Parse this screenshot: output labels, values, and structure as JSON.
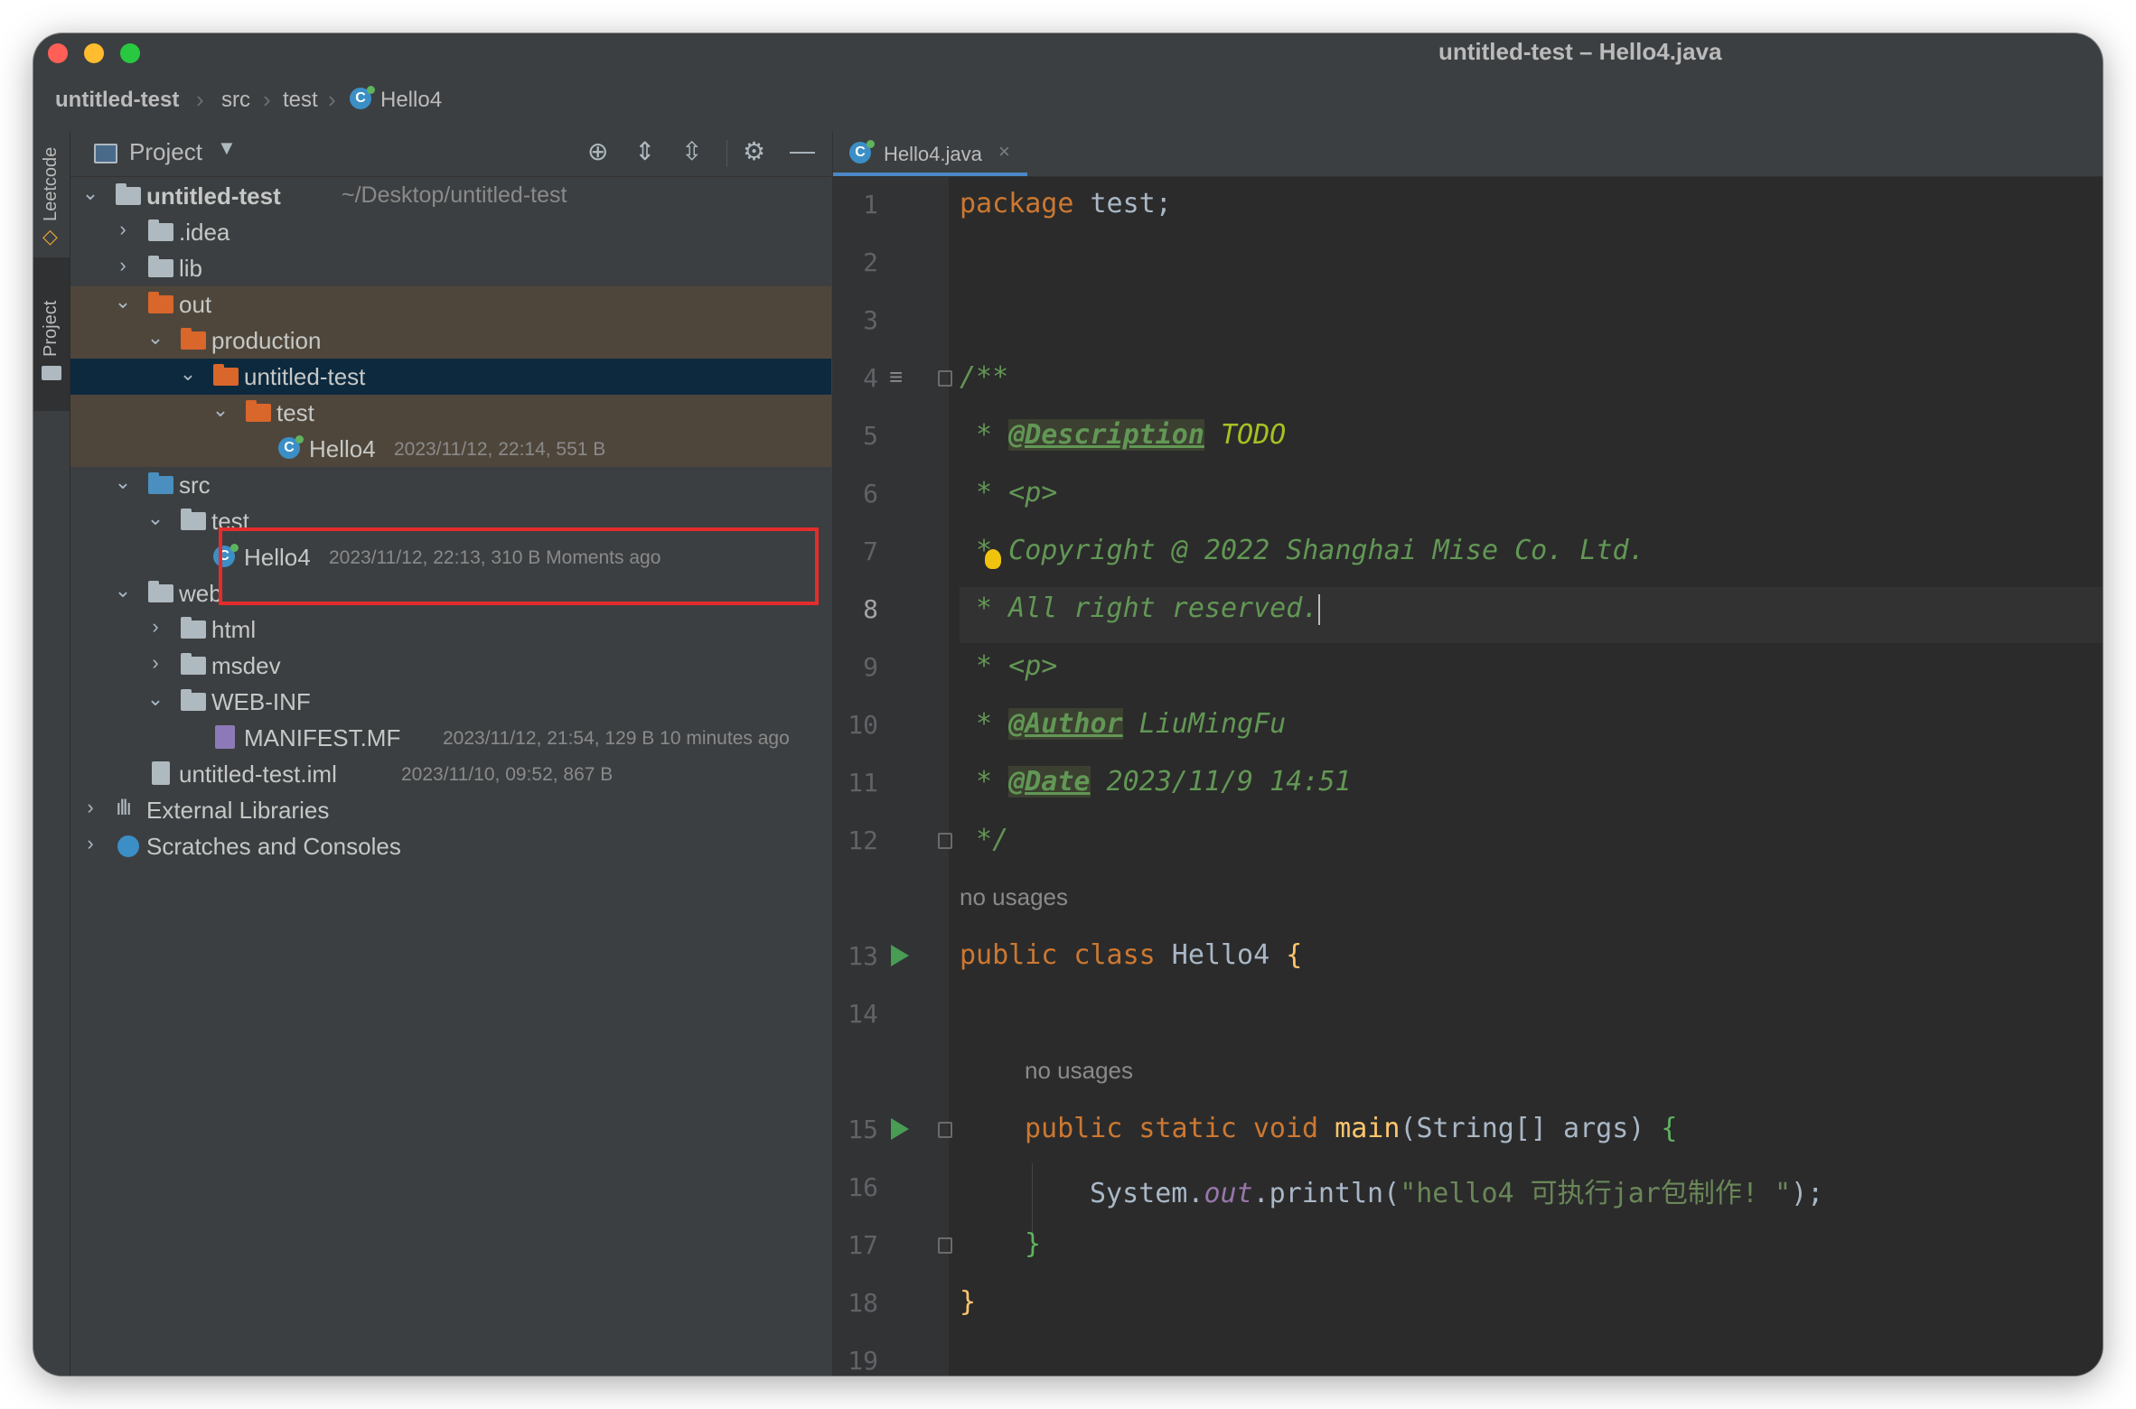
{
  "window": {
    "title": "untitled-test – Hello4.java"
  },
  "breadcrumb": [
    "untitled-test",
    "src",
    "test",
    "Hello4"
  ],
  "sidestrip": {
    "leetcode": "Leetcode",
    "project": "Project"
  },
  "project_panel": {
    "title": "Project"
  },
  "tree": {
    "root": {
      "name": "untitled-test",
      "path": "~/Desktop/untitled-test"
    },
    "idea": ".idea",
    "lib": "lib",
    "out": "out",
    "production": "production",
    "prod_untitled": "untitled-test",
    "prod_test": "test",
    "prod_hello": {
      "name": "Hello4",
      "meta": "2023/11/12, 22:14, 551 B"
    },
    "src": "src",
    "src_test": "test",
    "src_hello": {
      "name": "Hello4",
      "meta": "2023/11/12, 22:13, 310 B Moments ago"
    },
    "web": "web",
    "html": "html",
    "msdev": "msdev",
    "webinf": "WEB-INF",
    "manifest": {
      "name": "MANIFEST.MF",
      "meta": "2023/11/12, 21:54, 129 B 10 minutes ago"
    },
    "iml": {
      "name": "untitled-test.iml",
      "meta": "2023/11/10, 09:52, 867 B"
    },
    "external": "External Libraries",
    "scratches": "Scratches and Consoles"
  },
  "editor": {
    "tab": "Hello4.java",
    "line_numbers": [
      "1",
      "2",
      "3",
      "4",
      "5",
      "6",
      "7",
      "8",
      "9",
      "10",
      "11",
      "12",
      "13",
      "14",
      "15",
      "16",
      "17",
      "18",
      "19"
    ],
    "code": {
      "l1_kw": "package",
      "l1_rest": " test;",
      "l4": "/**",
      "l5_star": " * ",
      "l5_tag": "@Description",
      "l5_todo": " TODO",
      "l6": " * <p>",
      "l7": " * Copyright @ 2022 Shanghai Mise Co. Ltd.",
      "l8": " * All right reserved.",
      "l9": " * <p>",
      "l10_star": " * ",
      "l10_tag": "@Author",
      "l10_rest": " LiuMingFu",
      "l11_star": " * ",
      "l11_tag": "@Date",
      "l11_rest": " 2023/11/9 14:51",
      "l12": " */",
      "hint1": "no usages",
      "l13_kw": "public class",
      "l13_name": " Hello4 ",
      "l13_brace": "{",
      "hint2": "no usages",
      "l15_kw": "public static void",
      "l15_fn": "main",
      "l15_rest": "(String[] args) ",
      "l15_brace": "{",
      "l16_a": "System.",
      "l16_field": "out",
      "l16_b": ".println(",
      "l16_str": "\"hello4 可执行jar包制作! \"",
      "l16_c": ");",
      "l17": "}",
      "l18": "}"
    }
  }
}
